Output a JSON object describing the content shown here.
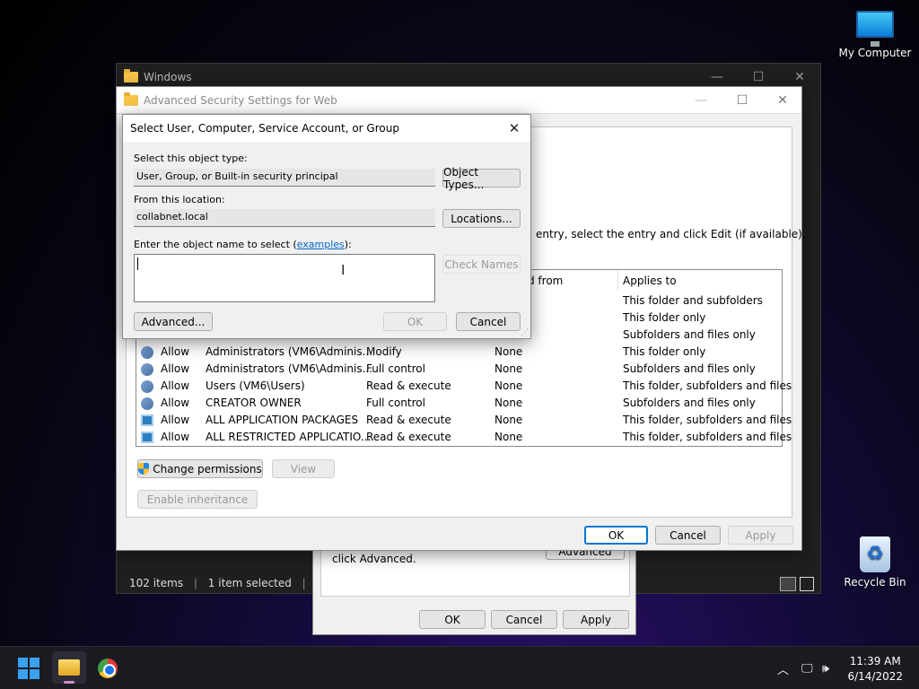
{
  "desktop": {
    "my_computer": "My Computer",
    "recycle_bin": "Recycle Bin"
  },
  "explorer": {
    "title": "Windows",
    "status_items": "102 items",
    "status_selected": "1 item selected"
  },
  "properties_dialog": {
    "text_advanced": "click Advanced.",
    "advanced_button": "Advanced",
    "ok": "OK",
    "cancel": "Cancel",
    "apply": "Apply"
  },
  "advanced_security": {
    "title": "Advanced Security Settings for Web",
    "instruction_text": "entry, select the entry and click Edit (if available).",
    "columns": {
      "inherited_from": "d from",
      "applies_to": "Applies to"
    },
    "partial_rows": [
      {
        "applies_to": "This folder and subfolders"
      },
      {
        "applies_to": "This folder only"
      },
      {
        "applies_to": "Subfolders and files only"
      }
    ],
    "rows": [
      {
        "icon": "user-group-icon",
        "type": "Allow",
        "principal": "Administrators (VM6\\Adminis...",
        "access": "Modify",
        "inherited": "None",
        "applies_to": "This folder only"
      },
      {
        "icon": "user-group-icon",
        "type": "Allow",
        "principal": "Administrators (VM6\\Adminis...",
        "access": "Full control",
        "inherited": "None",
        "applies_to": "Subfolders and files only"
      },
      {
        "icon": "user-group-icon",
        "type": "Allow",
        "principal": "Users (VM6\\Users)",
        "access": "Read & execute",
        "inherited": "None",
        "applies_to": "This folder, subfolders and files"
      },
      {
        "icon": "user-group-icon",
        "type": "Allow",
        "principal": "CREATOR OWNER",
        "access": "Full control",
        "inherited": "None",
        "applies_to": "Subfolders and files only"
      },
      {
        "icon": "package-icon",
        "type": "Allow",
        "principal": "ALL APPLICATION PACKAGES",
        "access": "Read & execute",
        "inherited": "None",
        "applies_to": "This folder, subfolders and files"
      },
      {
        "icon": "package-icon",
        "type": "Allow",
        "principal": "ALL RESTRICTED APPLICATIO...",
        "access": "Read & execute",
        "inherited": "None",
        "applies_to": "This folder, subfolders and files"
      }
    ],
    "change_permissions": "Change permissions",
    "view": "View",
    "enable_inheritance": "Enable inheritance",
    "ok": "OK",
    "cancel": "Cancel",
    "apply": "Apply"
  },
  "select_dialog": {
    "title": "Select User, Computer, Service Account, or Group",
    "object_type_label": "Select this object type:",
    "object_type_value": "User, Group, or Built-in security principal",
    "object_types_button": "Object Types...",
    "location_label": "From this location:",
    "location_value": "collabnet.local",
    "locations_button": "Locations...",
    "enter_label_prefix": "Enter the object name to select (",
    "enter_label_link": "examples",
    "enter_label_suffix": "):",
    "object_name_value": "",
    "check_names_button": "Check Names",
    "advanced_button": "Advanced...",
    "ok_button": "OK",
    "cancel_button": "Cancel"
  },
  "taskbar": {
    "time": "11:39 AM",
    "date": "6/14/2022"
  },
  "colors": {
    "accent": "#0078d4",
    "link": "#0066cc"
  }
}
